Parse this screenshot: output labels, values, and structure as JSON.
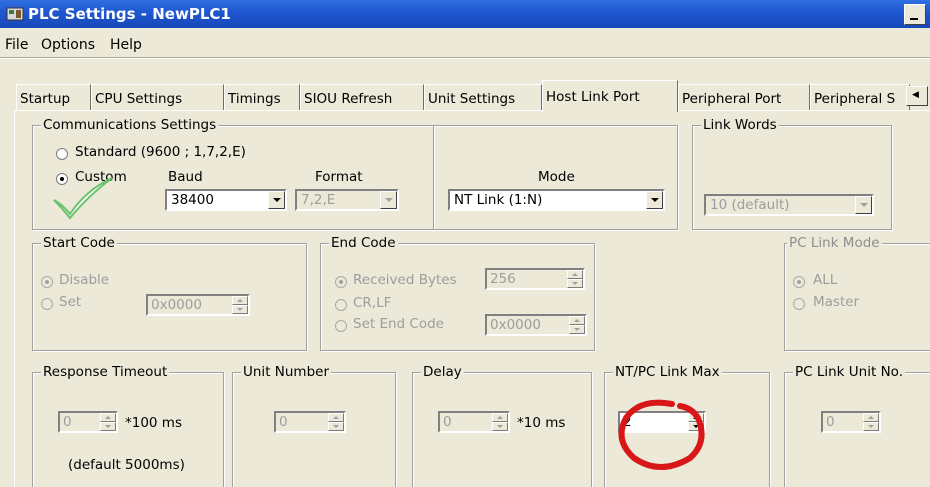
{
  "window": {
    "title": "PLC Settings - NewPLC1"
  },
  "menu": [
    "File",
    "Options",
    "Help"
  ],
  "tabs": [
    {
      "label": "Startup"
    },
    {
      "label": "CPU Settings"
    },
    {
      "label": "Timings"
    },
    {
      "label": "SIOU Refresh"
    },
    {
      "label": "Unit Settings"
    },
    {
      "label": "Host Link Port",
      "active": true
    },
    {
      "label": "Peripheral Port"
    },
    {
      "label": "Peripheral S"
    }
  ],
  "comm": {
    "legend": "Communications Settings",
    "standard_label": "Standard (9600 ; 1,7,2,E)",
    "custom_label": "Custom",
    "selected": "Custom",
    "baud_label": "Baud",
    "baud_value": "38400",
    "format_label": "Format",
    "format_value": "7,2,E",
    "mode_label": "Mode",
    "mode_value": "NT Link (1:N)"
  },
  "link_words": {
    "legend": "Link Words",
    "value": "10 (default)"
  },
  "start_code": {
    "legend": "Start Code",
    "disable_label": "Disable",
    "set_label": "Set",
    "value": "0x0000"
  },
  "end_code": {
    "legend": "End Code",
    "received_label": "Received Bytes",
    "received_value": "256",
    "crlf_label": "CR,LF",
    "set_end_label": "Set End Code",
    "set_end_value": "0x0000"
  },
  "pc_link_mode": {
    "legend": "PC Link Mode",
    "all_label": "ALL",
    "master_label": "Master"
  },
  "response_timeout": {
    "legend": "Response Timeout",
    "value": "0",
    "unit": "*100 ms",
    "note": "(default 5000ms)"
  },
  "unit_number": {
    "legend": "Unit Number",
    "value": "0"
  },
  "delay": {
    "legend": "Delay",
    "value": "0",
    "unit": "*10 ms"
  },
  "nt_pc_link_max": {
    "legend": "NT/PC Link Max",
    "value": "2"
  },
  "pc_link_unit_no": {
    "legend": "PC Link Unit No.",
    "value": "0"
  },
  "annotation_colors": {
    "check": "#6cc26c",
    "circle": "#d81818"
  }
}
